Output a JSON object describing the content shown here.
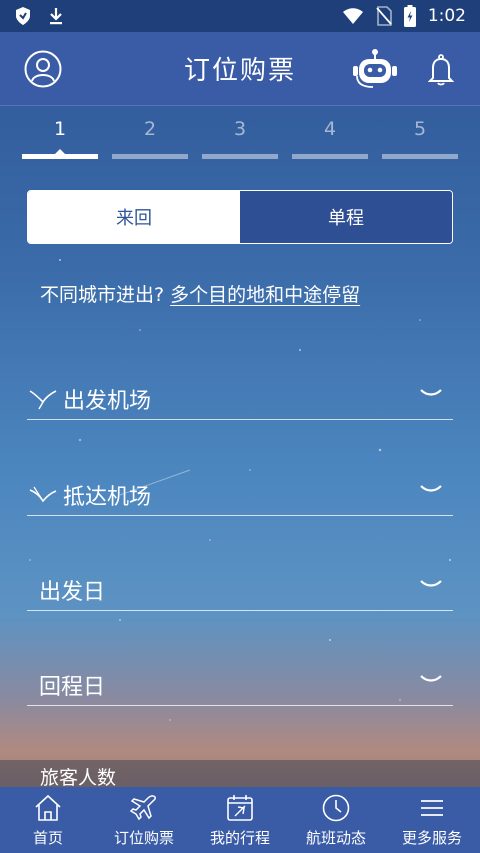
{
  "status_bar": {
    "time": "1:02",
    "icons": [
      "shield-icon",
      "download-icon",
      "wifi-icon",
      "no-sim-icon",
      "battery-icon"
    ]
  },
  "header": {
    "title": "订位购票",
    "icons": [
      "avatar-icon",
      "robot-assistant-icon",
      "bell-icon"
    ]
  },
  "steps": [
    {
      "label": "1",
      "active": true
    },
    {
      "label": "2",
      "active": false
    },
    {
      "label": "3",
      "active": false
    },
    {
      "label": "4",
      "active": false
    },
    {
      "label": "5",
      "active": false
    }
  ],
  "trip_type": {
    "round_trip": "来回",
    "one_way": "单程",
    "selected": "round_trip"
  },
  "multi_city": {
    "prompt": "不同城市进出?",
    "link": "多个目的地和中途停留"
  },
  "fields": {
    "departure_airport": "出发机场",
    "arrival_airport": "抵达机场",
    "departure_date": "出发日",
    "return_date": "回程日",
    "passengers": "旅客人数"
  },
  "bottom_nav": [
    {
      "label": "首页",
      "icon": "home-icon"
    },
    {
      "label": "订位购票",
      "icon": "plane-icon"
    },
    {
      "label": "我的行程",
      "icon": "calendar-plane-icon"
    },
    {
      "label": "航班动态",
      "icon": "clock-icon"
    },
    {
      "label": "更多服务",
      "icon": "menu-icon"
    }
  ],
  "colors": {
    "header_bg": "#3a5ba6",
    "status_bg": "#1f3f7a",
    "accent": "#2f5597"
  }
}
